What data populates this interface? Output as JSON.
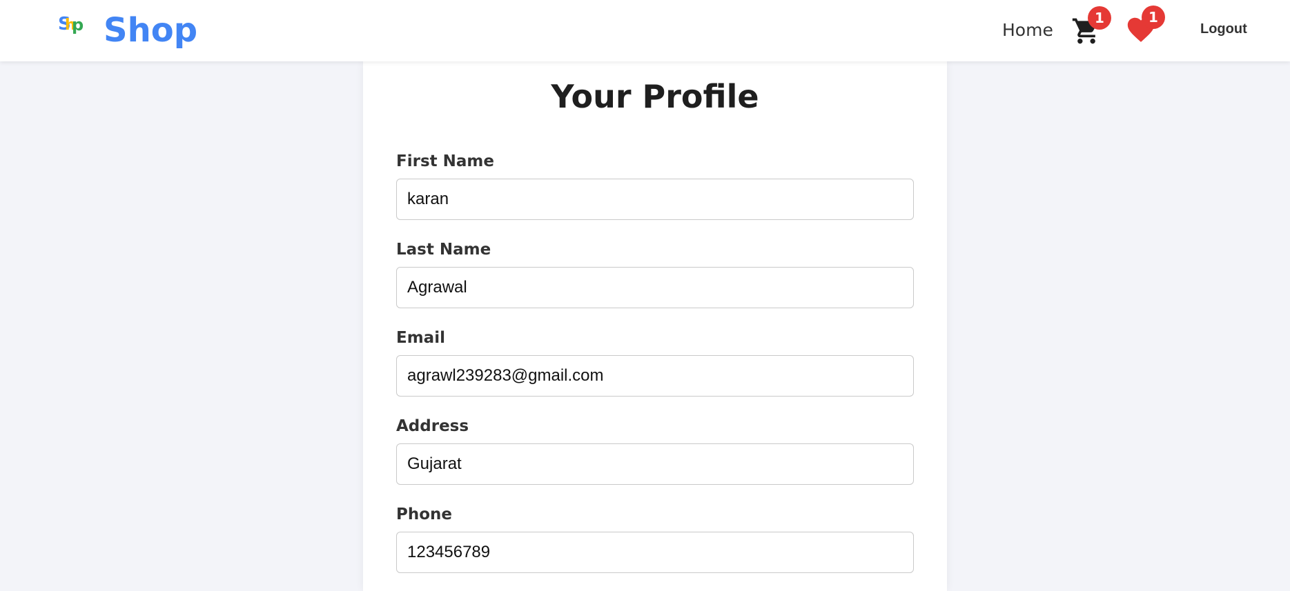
{
  "nav": {
    "logo_letters": [
      "S",
      "h",
      "p"
    ],
    "brand": "Shop",
    "home": "Home",
    "cart_count": "1",
    "wishlist_count": "1",
    "logout": "Logout"
  },
  "profile": {
    "title": "Your Profile",
    "fields": [
      {
        "label": "First Name",
        "value": "karan"
      },
      {
        "label": "Last Name",
        "value": "Agrawal"
      },
      {
        "label": "Email",
        "value": "agrawl239283@gmail.com"
      },
      {
        "label": "Address",
        "value": "Gujarat"
      },
      {
        "label": "Phone",
        "value": "123456789"
      }
    ]
  },
  "colors": {
    "brand": "#4285f4",
    "badge": "#e53935",
    "heart": "#e53935",
    "logo_1": "#4285f4",
    "logo_2": "#fbbc05",
    "logo_3": "#34a853"
  },
  "icons": {
    "cart": "shopping-cart-icon",
    "wishlist": "heart-icon"
  }
}
